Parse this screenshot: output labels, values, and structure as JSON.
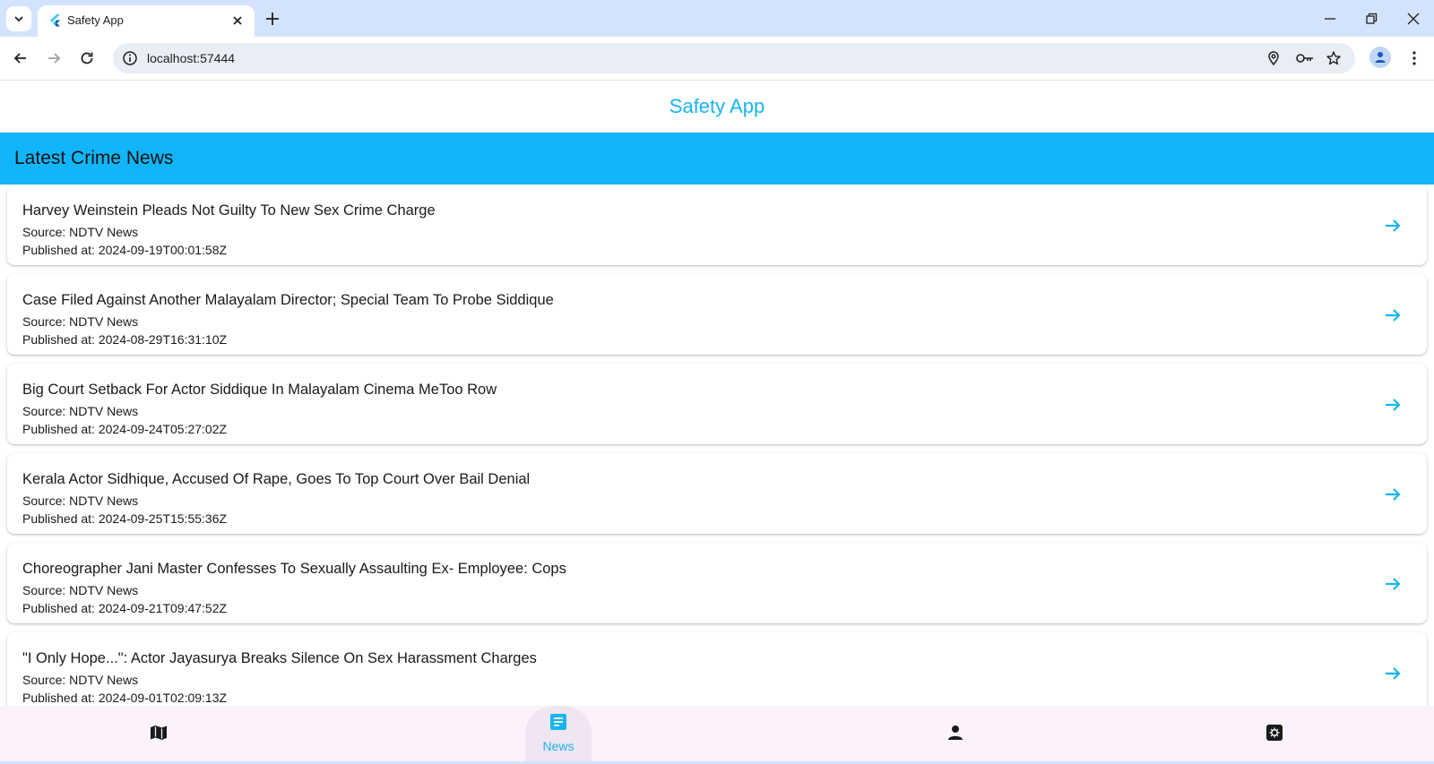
{
  "browser": {
    "tab_title": "Safety App",
    "url": "localhost:57444"
  },
  "app": {
    "title": "Safety App",
    "section_title": "Latest Crime News",
    "accent_color": "#12b5f9"
  },
  "news": [
    {
      "headline": "Harvey Weinstein Pleads Not Guilty To New Sex Crime Charge",
      "source": "Source: NDTV News",
      "published": "Published at: 2024-09-19T00:01:58Z"
    },
    {
      "headline": "Case Filed Against Another Malayalam Director; Special Team To Probe Siddique",
      "source": "Source: NDTV News",
      "published": "Published at: 2024-08-29T16:31:10Z"
    },
    {
      "headline": "Big Court Setback For Actor Siddique In Malayalam Cinema MeToo Row",
      "source": "Source: NDTV News",
      "published": "Published at: 2024-09-24T05:27:02Z"
    },
    {
      "headline": "Kerala Actor Sidhique, Accused Of Rape, Goes To Top Court Over Bail Denial",
      "source": "Source: NDTV News",
      "published": "Published at: 2024-09-25T15:55:36Z"
    },
    {
      "headline": "Choreographer Jani Master Confesses To Sexually Assaulting Ex- Employee: Cops",
      "source": "Source: NDTV News",
      "published": "Published at: 2024-09-21T09:47:52Z"
    },
    {
      "headline": "\"I Only Hope...\": Actor Jayasurya Breaks Silence On Sex Harassment Charges",
      "source": "Source: NDTV News",
      "published": "Published at: 2024-09-01T02:09:13Z"
    }
  ],
  "bottom_nav": {
    "items": [
      {
        "icon": "map-icon"
      },
      {
        "icon": "news-icon",
        "label": "News",
        "active": true
      },
      {
        "icon": "person-icon"
      },
      {
        "icon": "camera-icon"
      }
    ]
  }
}
